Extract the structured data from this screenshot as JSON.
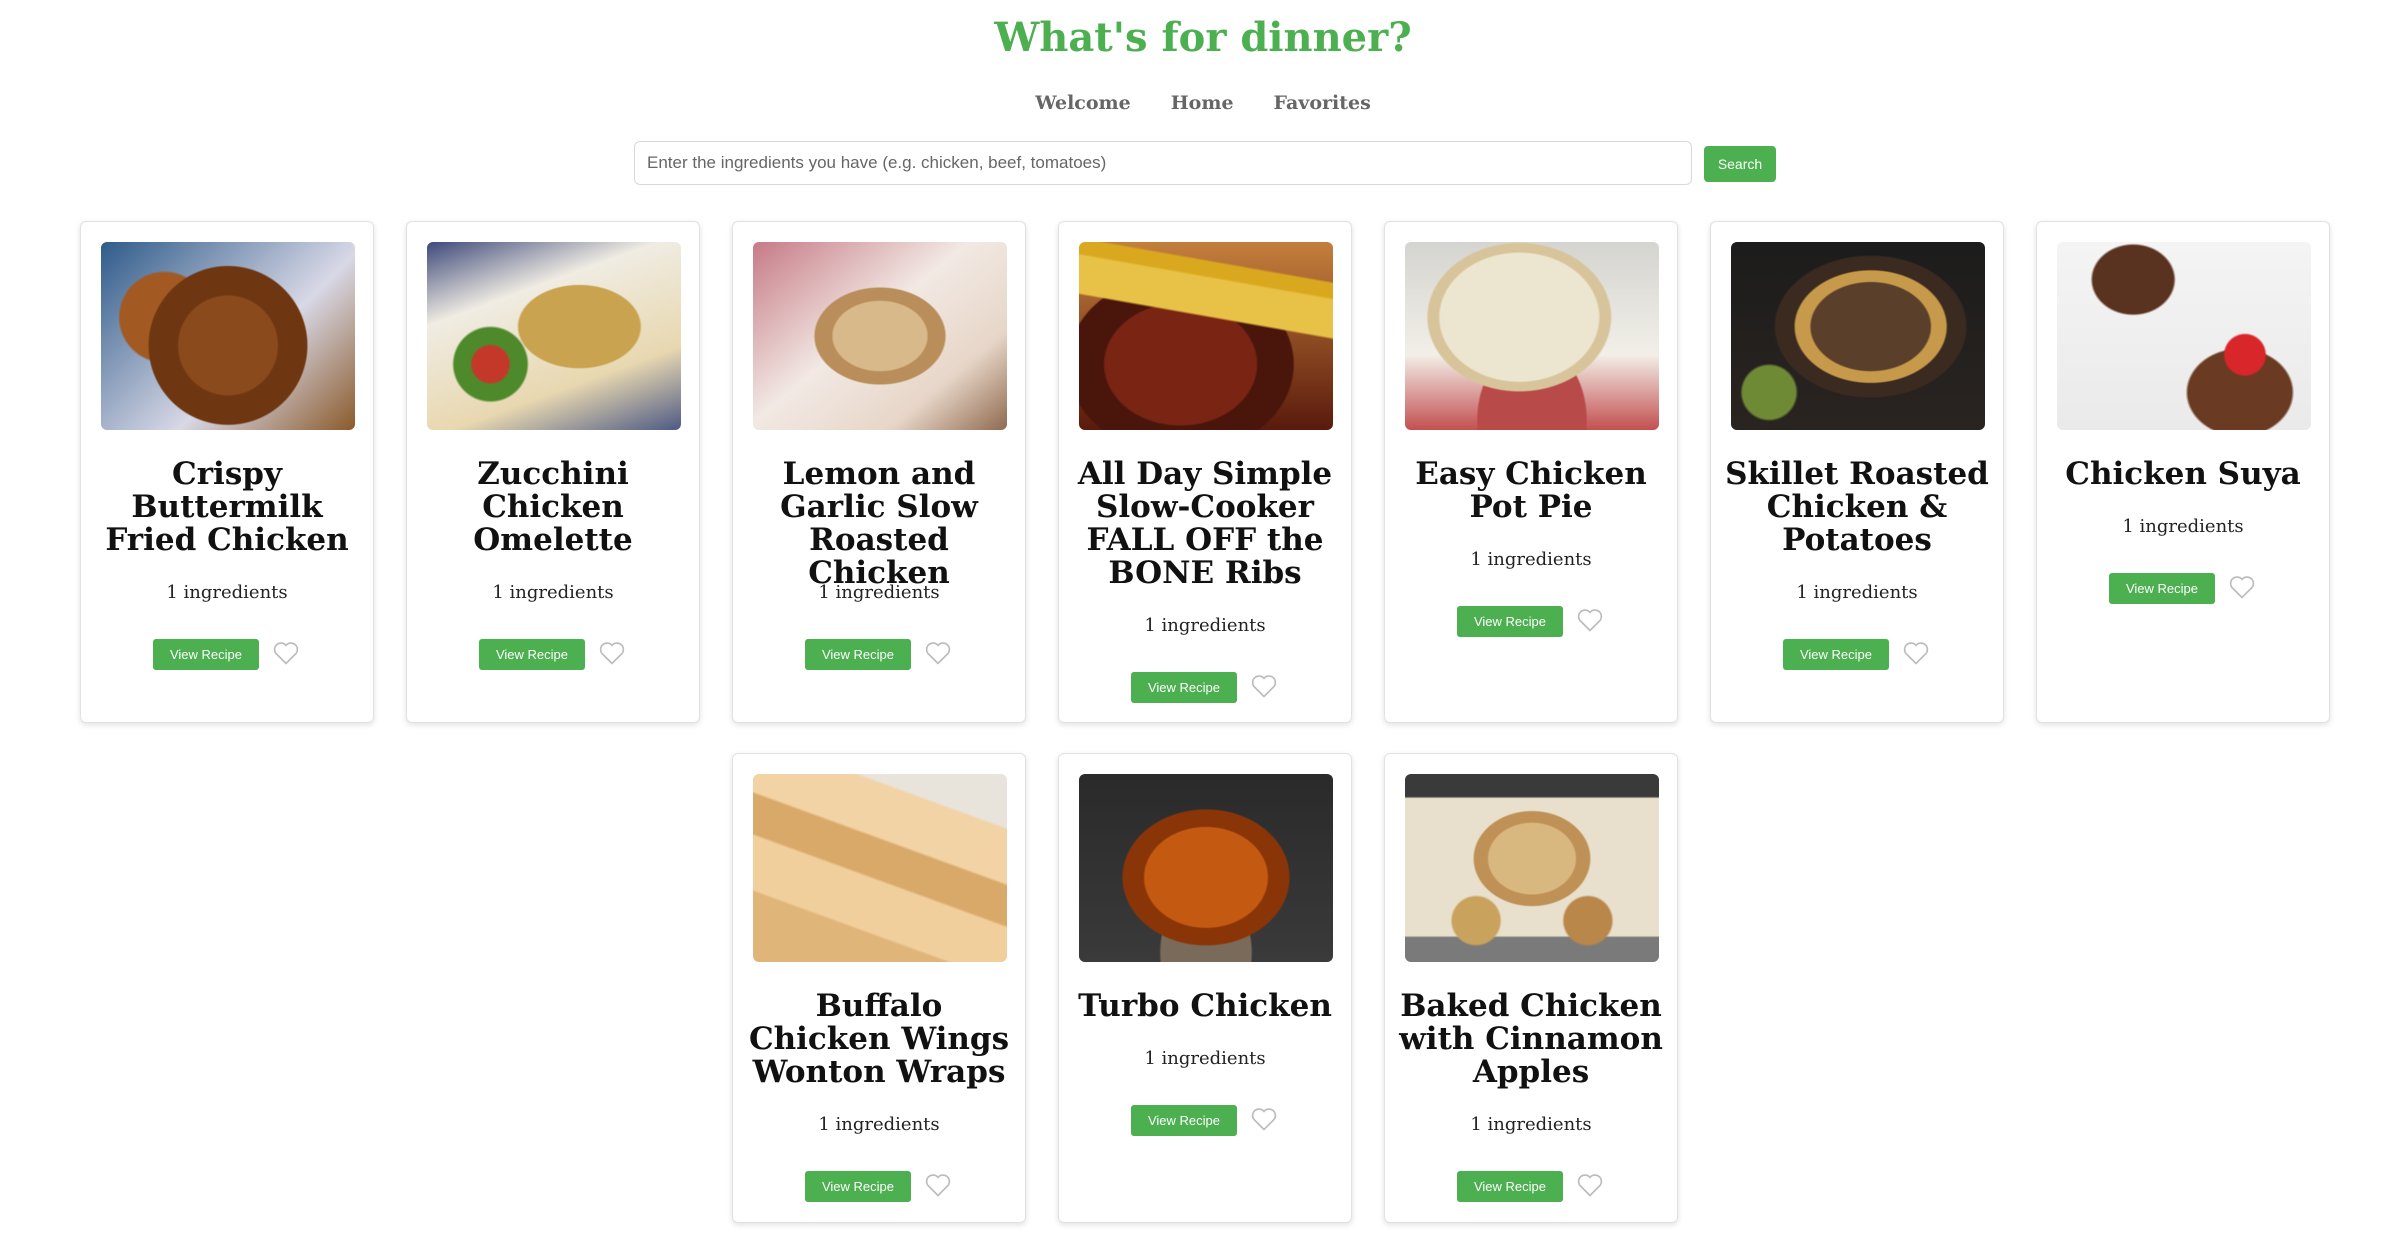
{
  "header": {
    "title": "What's for dinner?",
    "nav": [
      "Welcome",
      "Home",
      "Favorites"
    ]
  },
  "search": {
    "placeholder": "Enter the ingredients you have (e.g. chicken, beef, tomatoes)",
    "value": "",
    "button_label": "Search"
  },
  "colors": {
    "accent": "#4caf50",
    "nav_text": "#666666"
  },
  "recipes": [
    {
      "title": "Crispy Buttermilk Fried Chicken",
      "ingredients": "1 ingredients",
      "view_label": "View Recipe",
      "favorite_icon": "heart-outline-icon",
      "image": "fried-chicken-photo"
    },
    {
      "title": "Zucchini Chicken Omelette",
      "ingredients": "1 ingredients",
      "view_label": "View Recipe",
      "favorite_icon": "heart-outline-icon",
      "image": "omelette-photo"
    },
    {
      "title": "Lemon and Garlic Slow Roasted Chicken",
      "ingredients": "1 ingredients",
      "view_label": "View Recipe",
      "favorite_icon": "heart-outline-icon",
      "image": "roasted-chicken-photo"
    },
    {
      "title": "All Day Simple Slow-Cooker FALL OFF the BONE Ribs",
      "ingredients": "1 ingredients",
      "view_label": "View Recipe",
      "favorite_icon": "heart-outline-icon",
      "image": "ribs-photo"
    },
    {
      "title": "Easy Chicken Pot Pie",
      "ingredients": "1 ingredients",
      "view_label": "View Recipe",
      "favorite_icon": "heart-outline-icon",
      "image": "pot-pie-photo"
    },
    {
      "title": "Skillet Roasted Chicken & Potatoes",
      "ingredients": "1 ingredients",
      "view_label": "View Recipe",
      "favorite_icon": "heart-outline-icon",
      "image": "skillet-chicken-photo"
    },
    {
      "title": "Chicken Suya",
      "ingredients": "1 ingredients",
      "view_label": "View Recipe",
      "favorite_icon": "heart-outline-icon",
      "image": "suya-photo"
    },
    {
      "title": "Buffalo Chicken Wings Wonton Wraps",
      "ingredients": "1 ingredients",
      "view_label": "View Recipe",
      "favorite_icon": "heart-outline-icon",
      "image": "wonton-wraps-photo"
    },
    {
      "title": "Turbo Chicken",
      "ingredients": "1 ingredients",
      "view_label": "View Recipe",
      "favorite_icon": "heart-outline-icon",
      "image": "turbo-chicken-photo"
    },
    {
      "title": "Baked Chicken with Cinnamon Apples",
      "ingredients": "1 ingredients",
      "view_label": "View Recipe",
      "favorite_icon": "heart-outline-icon",
      "image": "baked-chicken-photo"
    }
  ]
}
